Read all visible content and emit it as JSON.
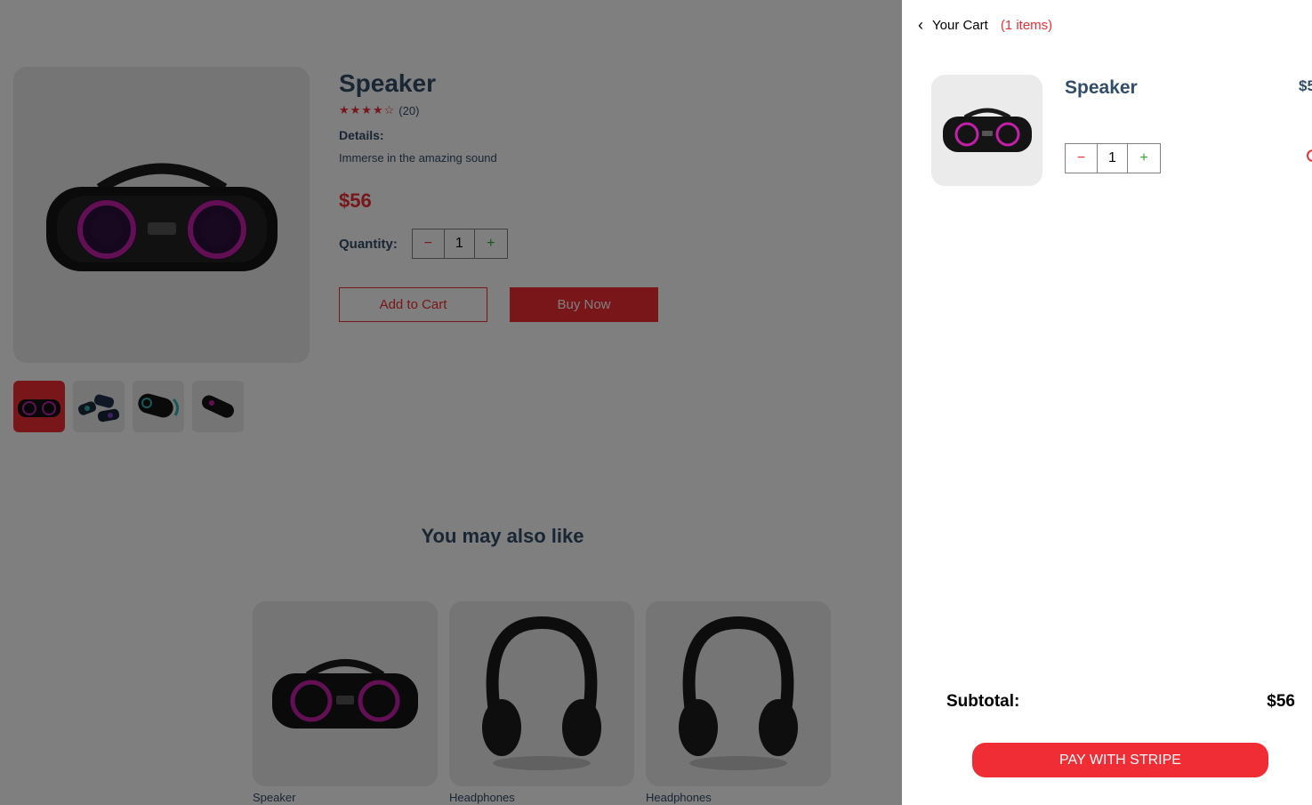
{
  "product": {
    "name": "Speaker",
    "rating": 4,
    "rating_max": 5,
    "review_count": "(20)",
    "details_label": "Details:",
    "details": "Immerse in the amazing sound",
    "price": "$56",
    "quantity_label": "Quantity:",
    "quantity": "1",
    "minus_symbol": "−",
    "plus_symbol": "+",
    "add_to_cart": "Add to Cart",
    "buy_now": "Buy Now",
    "thumbnails": [
      "speaker-front-image",
      "speaker-group-image",
      "speaker-side-image",
      "speaker-small-image"
    ],
    "selected_thumbnail": 0
  },
  "related": {
    "heading": "You may also like",
    "items": [
      {
        "name": "Speaker",
        "image": "speaker-image"
      },
      {
        "name": "Headphones",
        "image": "headphones-image"
      },
      {
        "name": "Headphones",
        "image": "headphones-image"
      }
    ]
  },
  "cart": {
    "title": "Your Cart",
    "count_text": "(1 items)",
    "item": {
      "name": "Speaker",
      "price": "$5",
      "quantity": "1",
      "minus_symbol": "−",
      "plus_symbol": "+"
    },
    "subtotal_label": "Subtotal:",
    "subtotal_value": "$56",
    "pay_button": "PAY WITH STRIPE"
  },
  "colors": {
    "accent": "#f02d34",
    "text": "#324d67",
    "image_bg": "#ebebeb",
    "plus": "#31a831"
  }
}
